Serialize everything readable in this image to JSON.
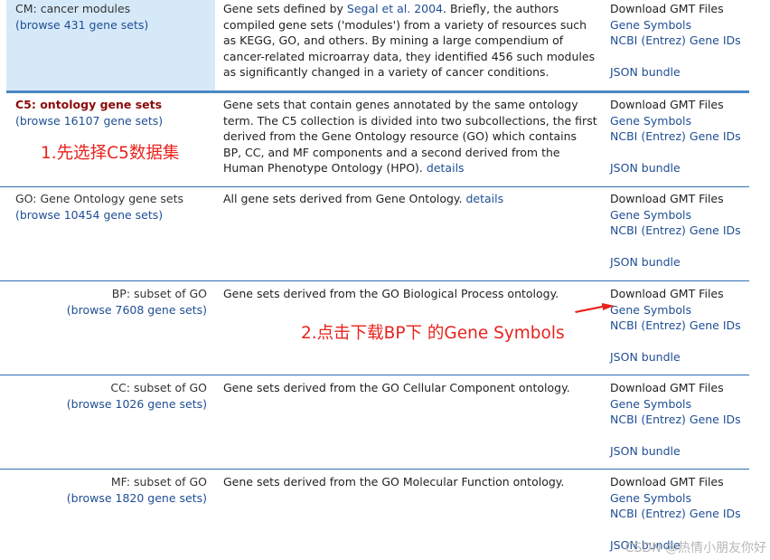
{
  "rows": [
    {
      "name": "CM: cancer modules",
      "browse": "(browse 431 gene sets)",
      "desc_pre": "Gene sets defined by",
      "desc_link": "Segal et al. 2004",
      "desc_post": ". Briefly, the authors compiled gene sets ('modules') from a variety of resources such as KEGG, GO, and others. By mining a large compendium of cancer-related microarray data, they identified 456 such modules as significantly changed in a variety of cancer conditions.",
      "links": [
        "Download GMT Files",
        "Gene Symbols",
        "NCBI (Entrez) Gene IDs",
        "JSON bundle"
      ]
    },
    {
      "name": "C5: ontology gene sets",
      "browse": "(browse 16107 gene sets)",
      "desc": "Gene sets that contain genes annotated by the same ontology term. The C5 collection is divided into two subcollections, the first derived from the Gene Ontology resource (GO) which contains BP, CC, and MF components and a second derived from the Human Phenotype Ontology (HPO).",
      "details": "details",
      "links": [
        "Download GMT Files",
        "Gene Symbols",
        "NCBI (Entrez) Gene IDs",
        "JSON bundle"
      ]
    },
    {
      "name": "GO: Gene Ontology gene sets",
      "browse": "(browse 10454 gene sets)",
      "desc": "All gene sets derived from Gene Ontology.",
      "details": "details",
      "links": [
        "Download GMT Files",
        "Gene Symbols",
        "NCBI (Entrez) Gene IDs",
        "JSON bundle"
      ]
    },
    {
      "name": "BP: subset of GO",
      "browse": "(browse 7608 gene sets)",
      "desc": "Gene sets derived from the GO Biological Process ontology.",
      "links": [
        "Download GMT Files",
        "Gene Symbols",
        "NCBI (Entrez) Gene IDs",
        "JSON bundle"
      ]
    },
    {
      "name": "CC: subset of GO",
      "browse": "(browse 1026 gene sets)",
      "desc": "Gene sets derived from the GO Cellular Component ontology.",
      "links": [
        "Download GMT Files",
        "Gene Symbols",
        "NCBI (Entrez) Gene IDs",
        "JSON bundle"
      ]
    },
    {
      "name": "MF: subset of GO",
      "browse": "(browse 1820 gene sets)",
      "desc": "Gene sets derived from the GO Molecular Function ontology.",
      "links": [
        "Download GMT Files",
        "Gene Symbols",
        "NCBI (Entrez) Gene IDs",
        "JSON bundle"
      ]
    }
  ],
  "annotations": {
    "step1": "1.先选择C5数据集",
    "step2": "2.点击下载BP下 的Gene Symbols"
  },
  "watermark": "CSDN @热情小朋友你好",
  "colors": {
    "link": "#1f4e94",
    "separator": "#2f6fb0",
    "highlight": "#d6e9f8",
    "annotation": "#e8231d",
    "c5_title": "#8b0a0a"
  }
}
